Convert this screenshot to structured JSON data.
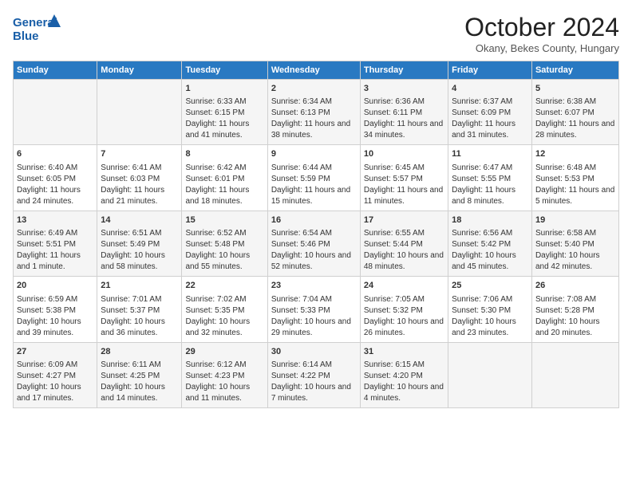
{
  "header": {
    "logo_line1": "General",
    "logo_line2": "Blue",
    "month_title": "October 2024",
    "subtitle": "Okany, Bekes County, Hungary"
  },
  "columns": [
    "Sunday",
    "Monday",
    "Tuesday",
    "Wednesday",
    "Thursday",
    "Friday",
    "Saturday"
  ],
  "weeks": [
    [
      {
        "day": "",
        "info": ""
      },
      {
        "day": "",
        "info": ""
      },
      {
        "day": "1",
        "info": "Sunrise: 6:33 AM\nSunset: 6:15 PM\nDaylight: 11 hours and 41 minutes."
      },
      {
        "day": "2",
        "info": "Sunrise: 6:34 AM\nSunset: 6:13 PM\nDaylight: 11 hours and 38 minutes."
      },
      {
        "day": "3",
        "info": "Sunrise: 6:36 AM\nSunset: 6:11 PM\nDaylight: 11 hours and 34 minutes."
      },
      {
        "day": "4",
        "info": "Sunrise: 6:37 AM\nSunset: 6:09 PM\nDaylight: 11 hours and 31 minutes."
      },
      {
        "day": "5",
        "info": "Sunrise: 6:38 AM\nSunset: 6:07 PM\nDaylight: 11 hours and 28 minutes."
      }
    ],
    [
      {
        "day": "6",
        "info": "Sunrise: 6:40 AM\nSunset: 6:05 PM\nDaylight: 11 hours and 24 minutes."
      },
      {
        "day": "7",
        "info": "Sunrise: 6:41 AM\nSunset: 6:03 PM\nDaylight: 11 hours and 21 minutes."
      },
      {
        "day": "8",
        "info": "Sunrise: 6:42 AM\nSunset: 6:01 PM\nDaylight: 11 hours and 18 minutes."
      },
      {
        "day": "9",
        "info": "Sunrise: 6:44 AM\nSunset: 5:59 PM\nDaylight: 11 hours and 15 minutes."
      },
      {
        "day": "10",
        "info": "Sunrise: 6:45 AM\nSunset: 5:57 PM\nDaylight: 11 hours and 11 minutes."
      },
      {
        "day": "11",
        "info": "Sunrise: 6:47 AM\nSunset: 5:55 PM\nDaylight: 11 hours and 8 minutes."
      },
      {
        "day": "12",
        "info": "Sunrise: 6:48 AM\nSunset: 5:53 PM\nDaylight: 11 hours and 5 minutes."
      }
    ],
    [
      {
        "day": "13",
        "info": "Sunrise: 6:49 AM\nSunset: 5:51 PM\nDaylight: 11 hours and 1 minute."
      },
      {
        "day": "14",
        "info": "Sunrise: 6:51 AM\nSunset: 5:49 PM\nDaylight: 10 hours and 58 minutes."
      },
      {
        "day": "15",
        "info": "Sunrise: 6:52 AM\nSunset: 5:48 PM\nDaylight: 10 hours and 55 minutes."
      },
      {
        "day": "16",
        "info": "Sunrise: 6:54 AM\nSunset: 5:46 PM\nDaylight: 10 hours and 52 minutes."
      },
      {
        "day": "17",
        "info": "Sunrise: 6:55 AM\nSunset: 5:44 PM\nDaylight: 10 hours and 48 minutes."
      },
      {
        "day": "18",
        "info": "Sunrise: 6:56 AM\nSunset: 5:42 PM\nDaylight: 10 hours and 45 minutes."
      },
      {
        "day": "19",
        "info": "Sunrise: 6:58 AM\nSunset: 5:40 PM\nDaylight: 10 hours and 42 minutes."
      }
    ],
    [
      {
        "day": "20",
        "info": "Sunrise: 6:59 AM\nSunset: 5:38 PM\nDaylight: 10 hours and 39 minutes."
      },
      {
        "day": "21",
        "info": "Sunrise: 7:01 AM\nSunset: 5:37 PM\nDaylight: 10 hours and 36 minutes."
      },
      {
        "day": "22",
        "info": "Sunrise: 7:02 AM\nSunset: 5:35 PM\nDaylight: 10 hours and 32 minutes."
      },
      {
        "day": "23",
        "info": "Sunrise: 7:04 AM\nSunset: 5:33 PM\nDaylight: 10 hours and 29 minutes."
      },
      {
        "day": "24",
        "info": "Sunrise: 7:05 AM\nSunset: 5:32 PM\nDaylight: 10 hours and 26 minutes."
      },
      {
        "day": "25",
        "info": "Sunrise: 7:06 AM\nSunset: 5:30 PM\nDaylight: 10 hours and 23 minutes."
      },
      {
        "day": "26",
        "info": "Sunrise: 7:08 AM\nSunset: 5:28 PM\nDaylight: 10 hours and 20 minutes."
      }
    ],
    [
      {
        "day": "27",
        "info": "Sunrise: 6:09 AM\nSunset: 4:27 PM\nDaylight: 10 hours and 17 minutes."
      },
      {
        "day": "28",
        "info": "Sunrise: 6:11 AM\nSunset: 4:25 PM\nDaylight: 10 hours and 14 minutes."
      },
      {
        "day": "29",
        "info": "Sunrise: 6:12 AM\nSunset: 4:23 PM\nDaylight: 10 hours and 11 minutes."
      },
      {
        "day": "30",
        "info": "Sunrise: 6:14 AM\nSunset: 4:22 PM\nDaylight: 10 hours and 7 minutes."
      },
      {
        "day": "31",
        "info": "Sunrise: 6:15 AM\nSunset: 4:20 PM\nDaylight: 10 hours and 4 minutes."
      },
      {
        "day": "",
        "info": ""
      },
      {
        "day": "",
        "info": ""
      }
    ]
  ]
}
